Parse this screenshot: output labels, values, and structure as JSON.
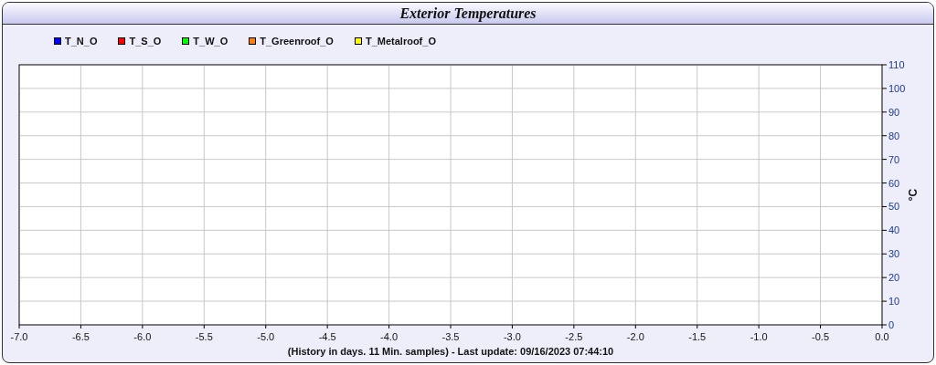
{
  "window": {
    "title": "Exterior Temperatures"
  },
  "chart": {
    "chart_data": {
      "type": "line",
      "grid": true,
      "xlabel": "(History in days. 11 Min. samples) - Last update: 09/16/2023 07:44:10",
      "ylabel": "°C",
      "series": [
        {
          "name": "T_N_O",
          "color": "#0000ff",
          "values": [
            null,
            null,
            null,
            null,
            null,
            null,
            null,
            null,
            null,
            null,
            null,
            null,
            null,
            null,
            null
          ]
        },
        {
          "name": "T_S_O",
          "color": "#ff0000",
          "values": [
            null,
            null,
            null,
            null,
            null,
            null,
            null,
            null,
            null,
            null,
            null,
            null,
            null,
            null,
            null
          ]
        },
        {
          "name": "T_W_O",
          "color": "#00ff00",
          "values": [
            null,
            null,
            null,
            null,
            null,
            null,
            null,
            null,
            null,
            null,
            null,
            null,
            null,
            null,
            null
          ]
        },
        {
          "name": "T_Greenroof_O",
          "color": "#ff8000",
          "values": [
            null,
            null,
            null,
            null,
            null,
            null,
            null,
            null,
            null,
            null,
            null,
            null,
            null,
            null,
            null
          ]
        },
        {
          "name": "T_Metalroof_O",
          "color": "#ffff00",
          "values": [
            null,
            null,
            null,
            null,
            null,
            null,
            null,
            null,
            null,
            null,
            null,
            null,
            null,
            null,
            null
          ]
        }
      ],
      "categories": [
        "-7.0",
        "-6.5",
        "-6.0",
        "-5.5",
        "-5.0",
        "-4.5",
        "-4.0",
        "-3.5",
        "-3.0",
        "-2.5",
        "-2.0",
        "-1.5",
        "-1.0",
        "-0.5",
        "0.0"
      ],
      "ylim": [
        0,
        110
      ],
      "yticks": [
        0,
        10,
        20,
        30,
        40,
        50,
        60,
        70,
        80,
        90,
        100,
        110
      ]
    }
  }
}
